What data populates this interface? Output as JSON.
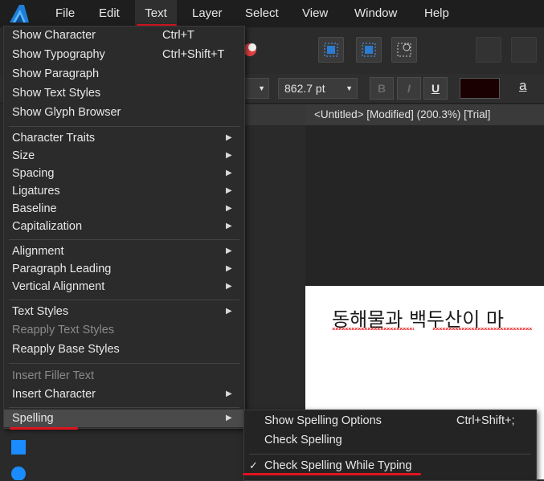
{
  "menubar": {
    "logo": "affinity-logo",
    "items": [
      "File",
      "Edit",
      "Text",
      "Layer",
      "Select",
      "View",
      "Window",
      "Help"
    ]
  },
  "context_bar": {
    "font_size": "862.7 pt",
    "bold": "B",
    "italic": "I",
    "underline": "U",
    "text_color": "#1a0000",
    "extra": "a"
  },
  "document": {
    "tab_title": "<Untitled> [Modified] (200.3%) [Trial]",
    "page_text": "동해물과 백두산이 마"
  },
  "text_menu": {
    "items": [
      {
        "label": "Show Character",
        "shortcut": "Ctrl+T"
      },
      {
        "label": "Show Typography",
        "shortcut": "Ctrl+Shift+T"
      },
      {
        "label": "Show Paragraph",
        "shortcut": ""
      },
      {
        "label": "Show Text Styles",
        "shortcut": ""
      },
      {
        "label": "Show Glyph Browser",
        "shortcut": ""
      },
      {
        "label": "Character Traits",
        "submenu": true
      },
      {
        "label": "Size",
        "submenu": true
      },
      {
        "label": "Spacing",
        "submenu": true
      },
      {
        "label": "Ligatures",
        "submenu": true
      },
      {
        "label": "Baseline",
        "submenu": true
      },
      {
        "label": "Capitalization",
        "submenu": true
      },
      {
        "label": "Alignment",
        "submenu": true
      },
      {
        "label": "Paragraph Leading",
        "submenu": true
      },
      {
        "label": "Vertical Alignment",
        "submenu": true
      },
      {
        "label": "Text Styles",
        "submenu": true
      },
      {
        "label": "Reapply Text Styles",
        "disabled": true
      },
      {
        "label": "Reapply Base Styles"
      },
      {
        "label": "Insert Filler Text",
        "disabled": true
      },
      {
        "label": "Insert Character",
        "submenu": true
      },
      {
        "label": "Spelling",
        "submenu": true,
        "highlighted": true
      }
    ]
  },
  "spelling_submenu": {
    "items": [
      {
        "label": "Show Spelling Options",
        "shortcut": "Ctrl+Shift+;"
      },
      {
        "label": "Check Spelling",
        "shortcut": ""
      },
      {
        "label": "Check Spelling While Typing",
        "checked": true,
        "check_mark": "✓"
      }
    ]
  },
  "colors": {
    "annotation_red": "#e0141e",
    "accent_blue": "#1a8cff"
  }
}
